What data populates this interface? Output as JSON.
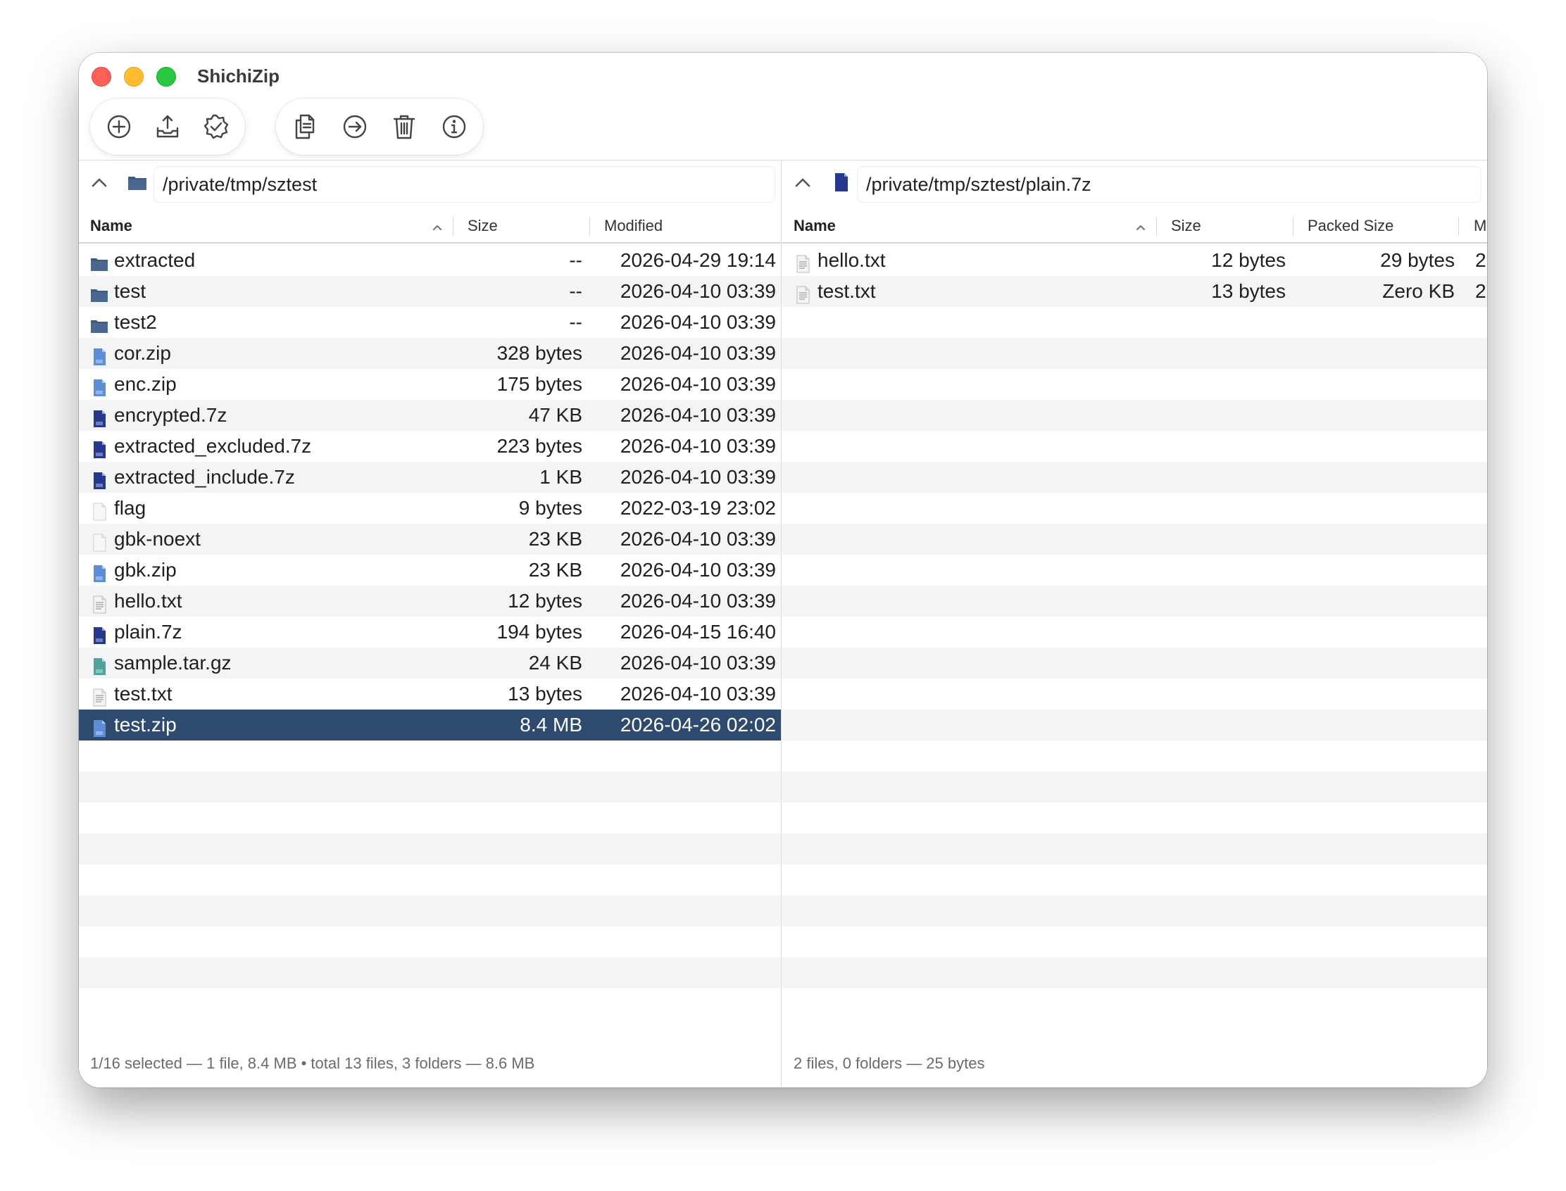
{
  "window": {
    "title": "ShichiZip"
  },
  "toolbar": {
    "group1": [
      {
        "name": "add-button",
        "icon": "plus-circle-icon"
      },
      {
        "name": "extract-button",
        "icon": "tray-arrow-up-icon"
      },
      {
        "name": "test-button",
        "icon": "check-seal-icon"
      }
    ],
    "group2": [
      {
        "name": "copy-button",
        "icon": "copy-docs-icon"
      },
      {
        "name": "move-button",
        "icon": "arrow-right-circle-icon"
      },
      {
        "name": "delete-button",
        "icon": "trash-icon"
      },
      {
        "name": "info-button",
        "icon": "info-circle-icon"
      }
    ]
  },
  "left_pane": {
    "path": "/private/tmp/sztest",
    "columns": {
      "name": "Name",
      "size": "Size",
      "modified": "Modified"
    },
    "rows": [
      {
        "name": "extracted",
        "size": "--",
        "modified": "2026-04-29 19:14",
        "kind": "folder"
      },
      {
        "name": "test",
        "size": "--",
        "modified": "2026-04-10 03:39",
        "kind": "folder"
      },
      {
        "name": "test2",
        "size": "--",
        "modified": "2026-04-10 03:39",
        "kind": "folder"
      },
      {
        "name": "cor.zip",
        "size": "328 bytes",
        "modified": "2026-04-10 03:39",
        "kind": "zip"
      },
      {
        "name": "enc.zip",
        "size": "175 bytes",
        "modified": "2026-04-10 03:39",
        "kind": "zip"
      },
      {
        "name": "encrypted.7z",
        "size": "47 KB",
        "modified": "2026-04-10 03:39",
        "kind": "7z"
      },
      {
        "name": "extracted_excluded.7z",
        "size": "223 bytes",
        "modified": "2026-04-10 03:39",
        "kind": "7z"
      },
      {
        "name": "extracted_include.7z",
        "size": "1 KB",
        "modified": "2026-04-10 03:39",
        "kind": "7z"
      },
      {
        "name": "flag",
        "size": "9 bytes",
        "modified": "2022-03-19 23:02",
        "kind": "blank"
      },
      {
        "name": "gbk-noext",
        "size": "23 KB",
        "modified": "2026-04-10 03:39",
        "kind": "blank"
      },
      {
        "name": "gbk.zip",
        "size": "23 KB",
        "modified": "2026-04-10 03:39",
        "kind": "zip"
      },
      {
        "name": "hello.txt",
        "size": "12 bytes",
        "modified": "2026-04-10 03:39",
        "kind": "text"
      },
      {
        "name": "plain.7z",
        "size": "194 bytes",
        "modified": "2026-04-15 16:40",
        "kind": "7z"
      },
      {
        "name": "sample.tar.gz",
        "size": "24 KB",
        "modified": "2026-04-10 03:39",
        "kind": "gz"
      },
      {
        "name": "test.txt",
        "size": "13 bytes",
        "modified": "2026-04-10 03:39",
        "kind": "text"
      },
      {
        "name": "test.zip",
        "size": "8.4 MB",
        "modified": "2026-04-26 02:02",
        "kind": "zip",
        "selected": true
      }
    ],
    "status": "1/16 selected — 1 file, 8.4 MB  •  total 13 files, 3 folders — 8.6 MB"
  },
  "right_pane": {
    "path": "/private/tmp/sztest/plain.7z",
    "columns": {
      "name": "Name",
      "size": "Size",
      "packed": "Packed Size",
      "modified": "Mo"
    },
    "rows": [
      {
        "name": "hello.txt",
        "size": "12 bytes",
        "packed": "29 bytes",
        "modified": "2",
        "kind": "text"
      },
      {
        "name": "test.txt",
        "size": "13 bytes",
        "packed": "Zero KB",
        "modified": "2",
        "kind": "text"
      }
    ],
    "status": "2 files, 0 folders — 25 bytes"
  },
  "colors": {
    "selection": "#2e4a6e",
    "folder": "#3d5a80",
    "zip": "#5b8ed6",
    "sevenzip": "#27398f",
    "gz": "#4fa39a"
  }
}
